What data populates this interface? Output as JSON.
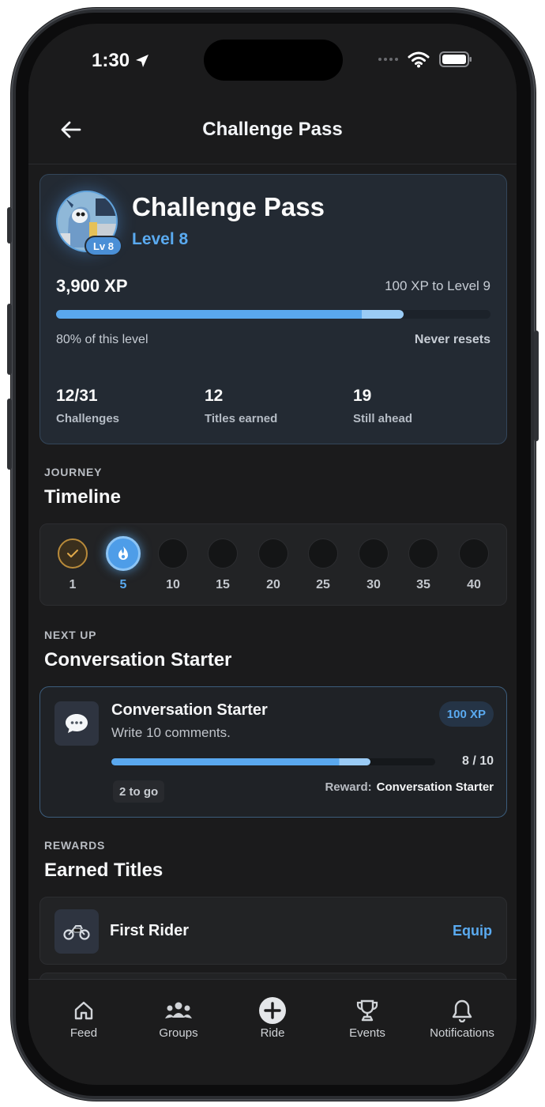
{
  "status_bar": {
    "time": "1:30"
  },
  "header": {
    "title": "Challenge Pass",
    "back_icon": "arrow-left-icon"
  },
  "hero": {
    "title": "Challenge Pass",
    "level_text": "Level 8",
    "level_badge": "Lv 8",
    "xp_total": "3,900 XP",
    "xp_to_next": "100 XP to Level 9",
    "progress_fraction": 0.8,
    "progress_text": "80% of this level",
    "reset_text": "Never resets",
    "stats": [
      {
        "value": "12/31",
        "label": "Challenges"
      },
      {
        "value": "12",
        "label": "Titles earned"
      },
      {
        "value": "19",
        "label": "Still ahead"
      }
    ]
  },
  "journey": {
    "kicker": "JOURNEY",
    "title": "Timeline",
    "milestones": [
      {
        "label": "1",
        "state": "done"
      },
      {
        "label": "5",
        "state": "current"
      },
      {
        "label": "10",
        "state": "locked"
      },
      {
        "label": "15",
        "state": "locked"
      },
      {
        "label": "20",
        "state": "locked"
      },
      {
        "label": "25",
        "state": "locked"
      },
      {
        "label": "30",
        "state": "locked"
      },
      {
        "label": "35",
        "state": "locked"
      },
      {
        "label": "40",
        "state": "locked"
      }
    ]
  },
  "next_up": {
    "kicker": "NEXT UP",
    "title": "Conversation Starter",
    "task": {
      "icon": "speech-bubble-icon",
      "title": "Conversation Starter",
      "description": "Write 10 comments.",
      "xp": "100 XP",
      "progress_fraction": 0.8,
      "count": "8 / 10",
      "to_go": "2 to go",
      "reward_label": "Reward:",
      "reward_name": "Conversation Starter"
    }
  },
  "rewards": {
    "kicker": "REWARDS",
    "title": "Earned Titles",
    "items": [
      {
        "icon": "motorcycle-icon",
        "name": "First Rider",
        "action": "Equip"
      }
    ]
  },
  "tab_bar": [
    {
      "label": "Feed",
      "icon": "home-icon"
    },
    {
      "label": "Groups",
      "icon": "groups-icon"
    },
    {
      "label": "Ride",
      "icon": "plus-circle-icon"
    },
    {
      "label": "Events",
      "icon": "trophy-icon"
    },
    {
      "label": "Notifications",
      "icon": "bell-icon"
    }
  ],
  "colors": {
    "accent": "#5aaaf0",
    "background": "#1b1b1c",
    "card": "#232a33",
    "done_gold": "#b88a3a"
  }
}
